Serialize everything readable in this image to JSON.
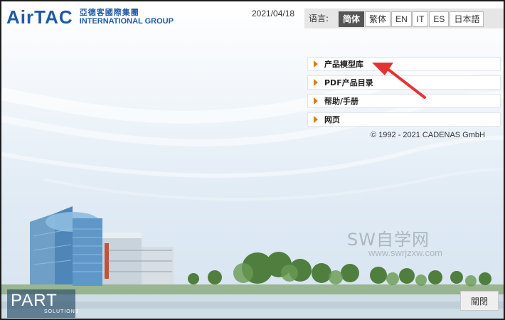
{
  "header": {
    "logo_mark": "AirTAC",
    "logo_cn": "亞德客國際集團",
    "logo_en": "INTERNATIONAL GROUP",
    "date": "2021/04/18"
  },
  "language": {
    "label": "语言:",
    "options": [
      "简体",
      "繁体",
      "EN",
      "IT",
      "ES",
      "日本語"
    ],
    "selected": "简体"
  },
  "menu": {
    "items": [
      "产品模型库",
      "PDF产品目录",
      "帮助/手册",
      "网页"
    ]
  },
  "copyright": "© 1992 - 2021 CADENAS GmbH",
  "footer": {
    "part_logo_big": "PART",
    "part_logo_small": "SOLUTIONS",
    "close_label": "關閉"
  },
  "watermark": {
    "big": "SW自学网",
    "small": "www.swrjzxw.com"
  },
  "colors": {
    "brand_blue": "#1e5aa8",
    "menu_triangle": "#e07a10",
    "active_lang_bg": "#555555",
    "annotation_arrow": "#e53333"
  },
  "icons": {
    "menu_bullet": "triangle-right-icon",
    "annotation": "red-arrow-icon"
  }
}
